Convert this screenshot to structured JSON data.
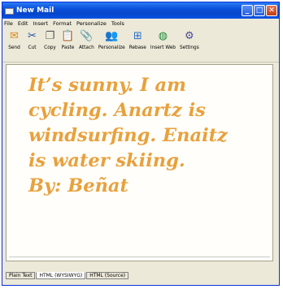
{
  "window": {
    "title": "New Mail",
    "minimize": "_",
    "maximize": "□",
    "close": "✕"
  },
  "menu": [
    "File",
    "Edit",
    "Insert",
    "Format",
    "Personalize",
    "Tools"
  ],
  "toolbar": [
    {
      "label": "Send",
      "icon": "send-icon",
      "glyph": "✉",
      "color": "#d88a16"
    },
    {
      "label": "Cut",
      "icon": "cut-icon",
      "glyph": "✂",
      "color": "#1d4fa8"
    },
    {
      "label": "Copy",
      "icon": "copy-icon",
      "glyph": "❐",
      "color": "#555555"
    },
    {
      "label": "Paste",
      "icon": "paste-icon",
      "glyph": "📋",
      "color": "#b88a3a"
    },
    {
      "label": "Attach",
      "icon": "attach-icon",
      "glyph": "📎",
      "color": "#2f8a2f"
    },
    {
      "label": "Personalize",
      "icon": "personalize-icon",
      "glyph": "👥",
      "color": "#8a3a1a"
    },
    {
      "label": "Rebase",
      "icon": "rebase-icon",
      "glyph": "⊞",
      "color": "#2a6fc8"
    },
    {
      "label": "Insert Web",
      "icon": "globe-icon",
      "glyph": "◍",
      "color": "#1f8a3a"
    },
    {
      "label": "Settings",
      "icon": "settings-icon",
      "glyph": "⚙",
      "color": "#4a4a9a"
    }
  ],
  "editor": {
    "lines": [
      "It’s sunny. I am",
      "cycling. Anartz is",
      "windsurfing. Enaitz",
      "is water skiing.",
      "By: Beñat"
    ],
    "text_color": "#e8a13d"
  },
  "tabs": [
    "Plain Text",
    "HTML (WYSIWYG)",
    "HTML (Source)"
  ],
  "active_tab": "HTML (WYSIWYG)"
}
